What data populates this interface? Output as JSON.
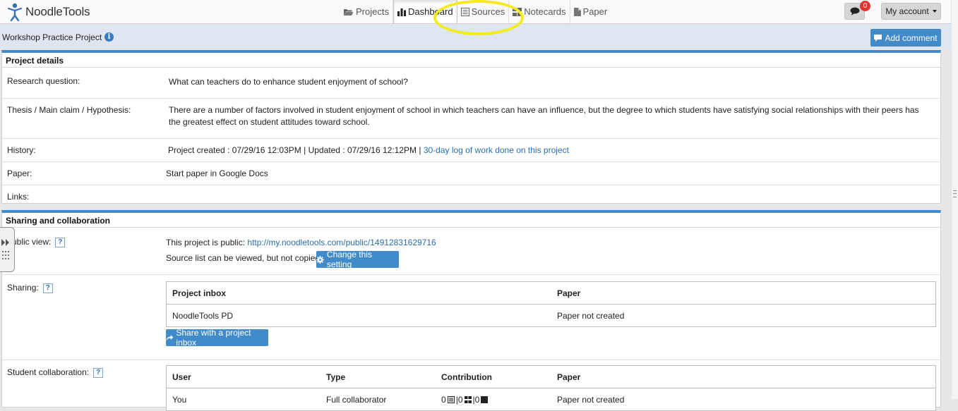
{
  "app": {
    "logo_text": "NoodleTools"
  },
  "nav": {
    "items": [
      {
        "label": "Projects",
        "icon": "folder-open-icon"
      },
      {
        "label": "Dashboard",
        "icon": "bar-chart-icon",
        "active": true
      },
      {
        "label": "Sources",
        "icon": "list-icon"
      },
      {
        "label": "Notecards",
        "icon": "notecards-icon"
      },
      {
        "label": "Paper",
        "icon": "document-icon"
      }
    ]
  },
  "topbar": {
    "chat_badge": "0",
    "account_label": "My account"
  },
  "project": {
    "title": "Workshop Practice Project",
    "add_comment_label": "Add comment"
  },
  "details": {
    "heading": "Project details",
    "research_question_label": "Research question:",
    "research_question": "What can teachers do to enhance student enjoyment of school?",
    "thesis_label": "Thesis / Main claim / Hypothesis:",
    "thesis": "There are a number of factors involved in student enjoyment of school in which teachers can have an influence, but the degree to which students have satisfying social relationships with their peers has the greatest effect on student attitudes toward school.",
    "history_label": "History:",
    "history_text": "Project created : 07/29/16 12:03PM | Updated : 07/29/16 12:12PM | ",
    "history_link": "30-day log of work done on this project",
    "paper_label": "Paper:",
    "paper_link": "Start paper in Google Docs",
    "links_label": "Links:"
  },
  "sharing": {
    "heading": "Sharing and collaboration",
    "public_view_label": "Public view:",
    "public_text": "This project is public: ",
    "public_url": "http://my.noodletools.com/public/14912831629716",
    "source_list_note": "Source list can be viewed, but not copied",
    "change_setting_label": "Change this setting",
    "sharing_label": "Sharing:",
    "inbox_table": {
      "headers": [
        "Project inbox",
        "Paper"
      ],
      "rows": [
        [
          "NoodleTools PD",
          "Paper not created"
        ]
      ]
    },
    "share_button_label": "Share with a project inbox",
    "collab_label": "Student collaboration:",
    "collab_table": {
      "headers": [
        "User",
        "Type",
        "Contribution",
        "Paper"
      ],
      "rows": [
        [
          "You",
          "Full collaborator",
          "0",
          "0",
          "0",
          "Paper not created"
        ]
      ]
    }
  },
  "colors": {
    "accent": "#428bca",
    "highlight": "#f3ec1a",
    "badge": "#e0342c"
  }
}
